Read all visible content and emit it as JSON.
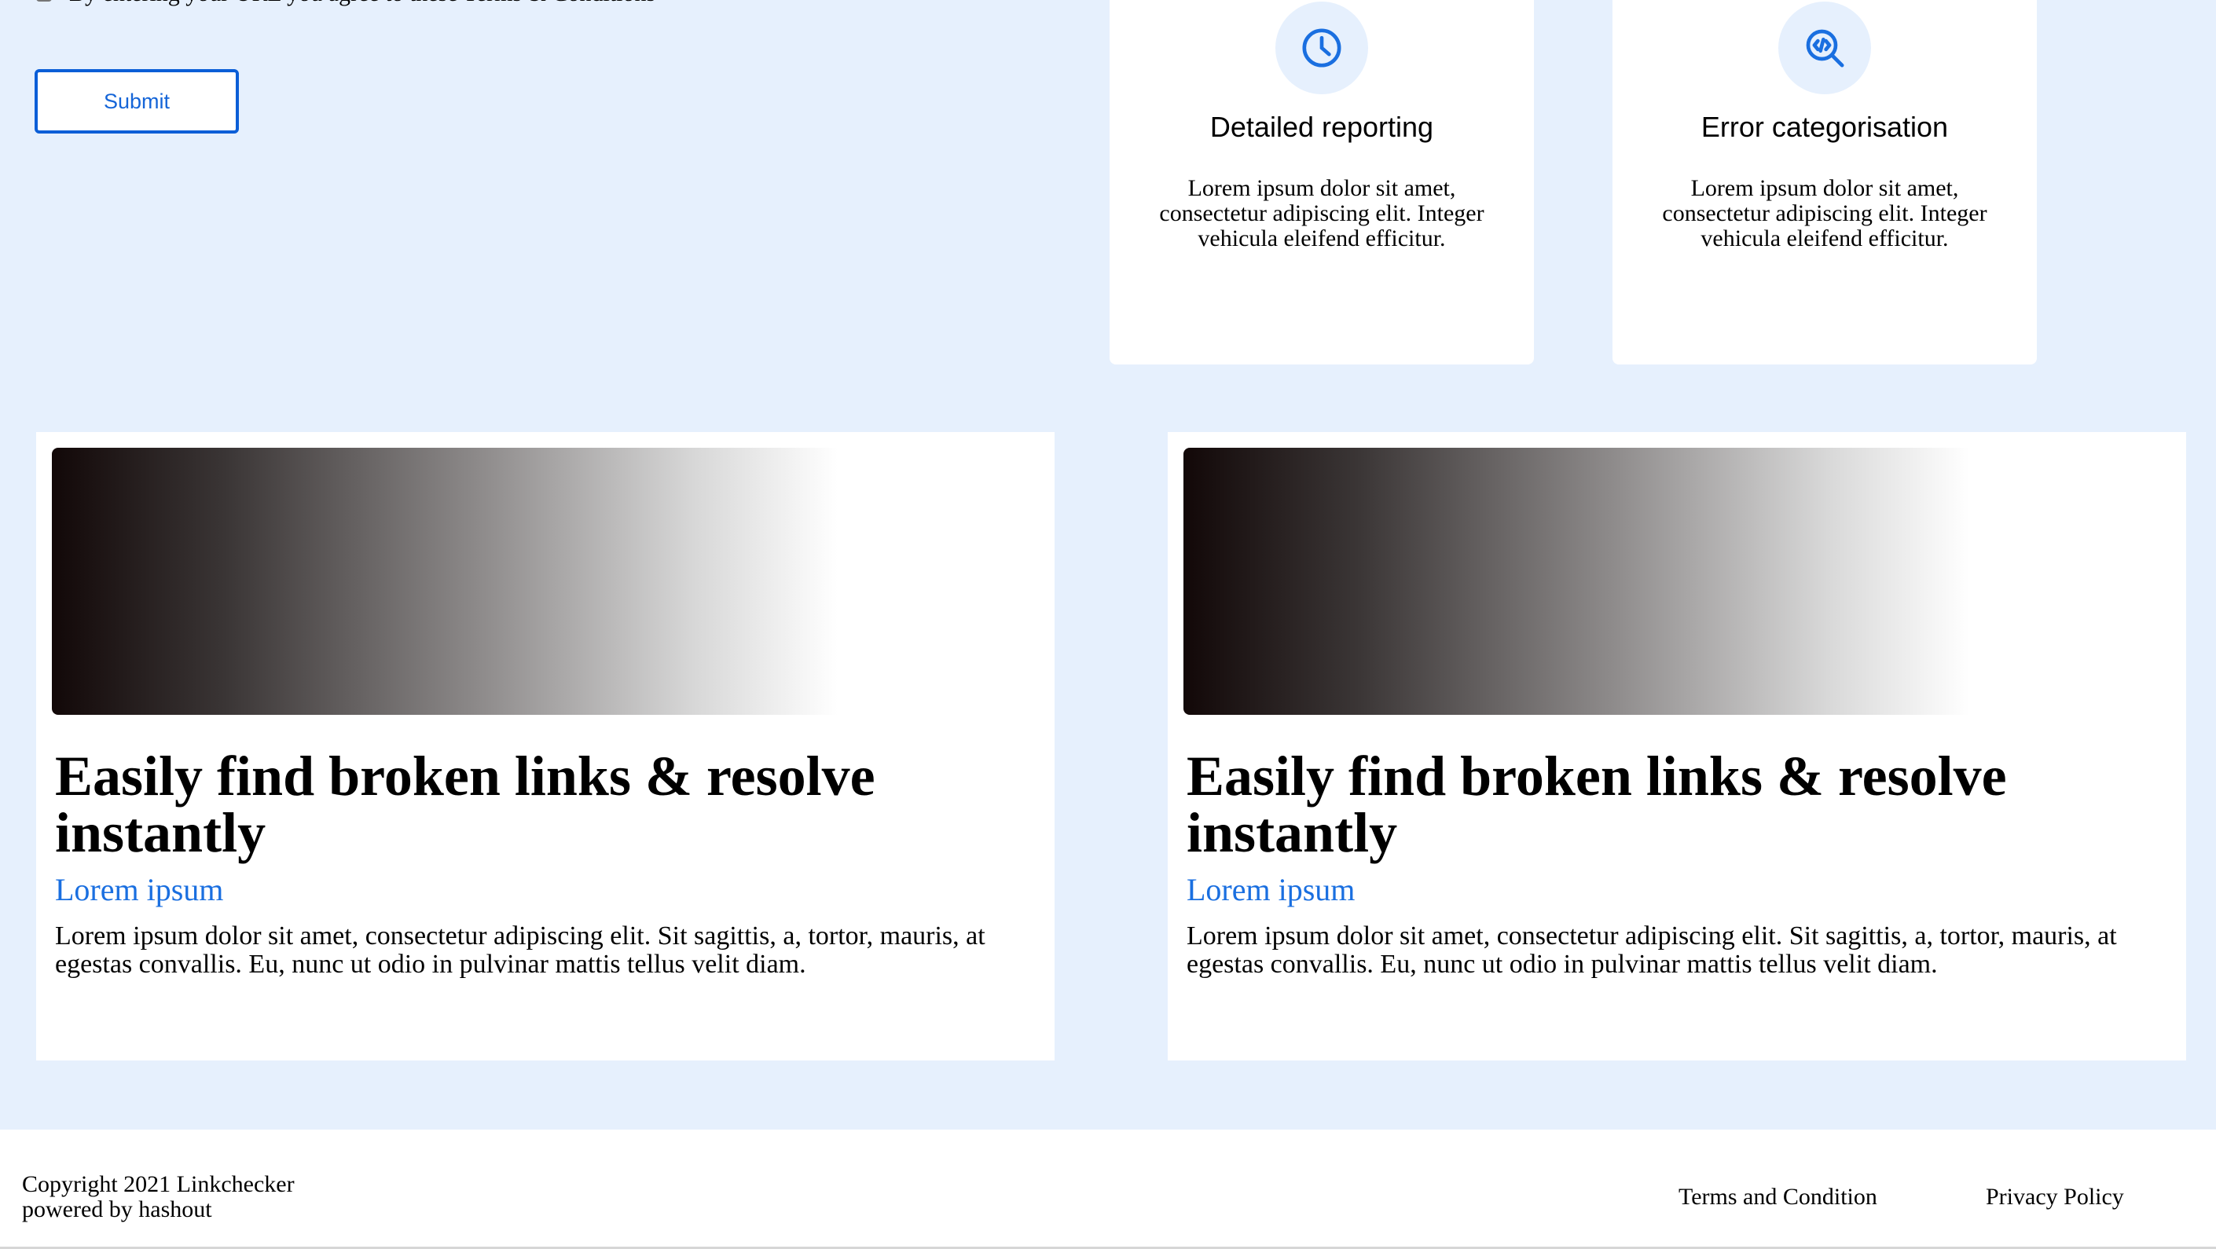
{
  "form": {
    "terms_label": "By entering your URL you agree to these Terms & Conditions",
    "terms_checked": false,
    "submit_label": "Submit"
  },
  "features": [
    {
      "icon": "clock-icon",
      "title": "Detailed reporting",
      "description": "Lorem ipsum dolor sit amet, consectetur adipiscing elit. Integer vehicula eleifend efficitur."
    },
    {
      "icon": "code-search-icon",
      "title": "Error categorisation",
      "description": "Lorem ipsum dolor sit amet, consectetur adipiscing elit. Integer vehicula eleifend efficitur."
    }
  ],
  "articles": [
    {
      "title": "Easily find broken links & resolve instantly",
      "subtitle": "Lorem ipsum",
      "body": "Lorem ipsum dolor sit amet, consectetur adipiscing elit. Sit sagittis, a, tortor, mauris, at egestas convallis. Eu, nunc ut odio in pulvinar mattis tellus velit diam."
    },
    {
      "title": "Easily find broken links & resolve instantly",
      "subtitle": "Lorem ipsum",
      "body": "Lorem ipsum dolor sit amet, consectetur adipiscing elit. Sit sagittis, a, tortor, mauris, at egestas convallis. Eu, nunc ut odio in pulvinar mattis tellus velit diam."
    }
  ],
  "footer": {
    "copyright": "Copyright 2021 Linkchecker",
    "powered_by": "powered by hashout",
    "links": [
      "Terms and Condition",
      "Privacy Policy"
    ]
  },
  "colors": {
    "page_background": "#e6f0fd",
    "accent": "#1a6fe0",
    "button_border": "#0b5ed7"
  }
}
